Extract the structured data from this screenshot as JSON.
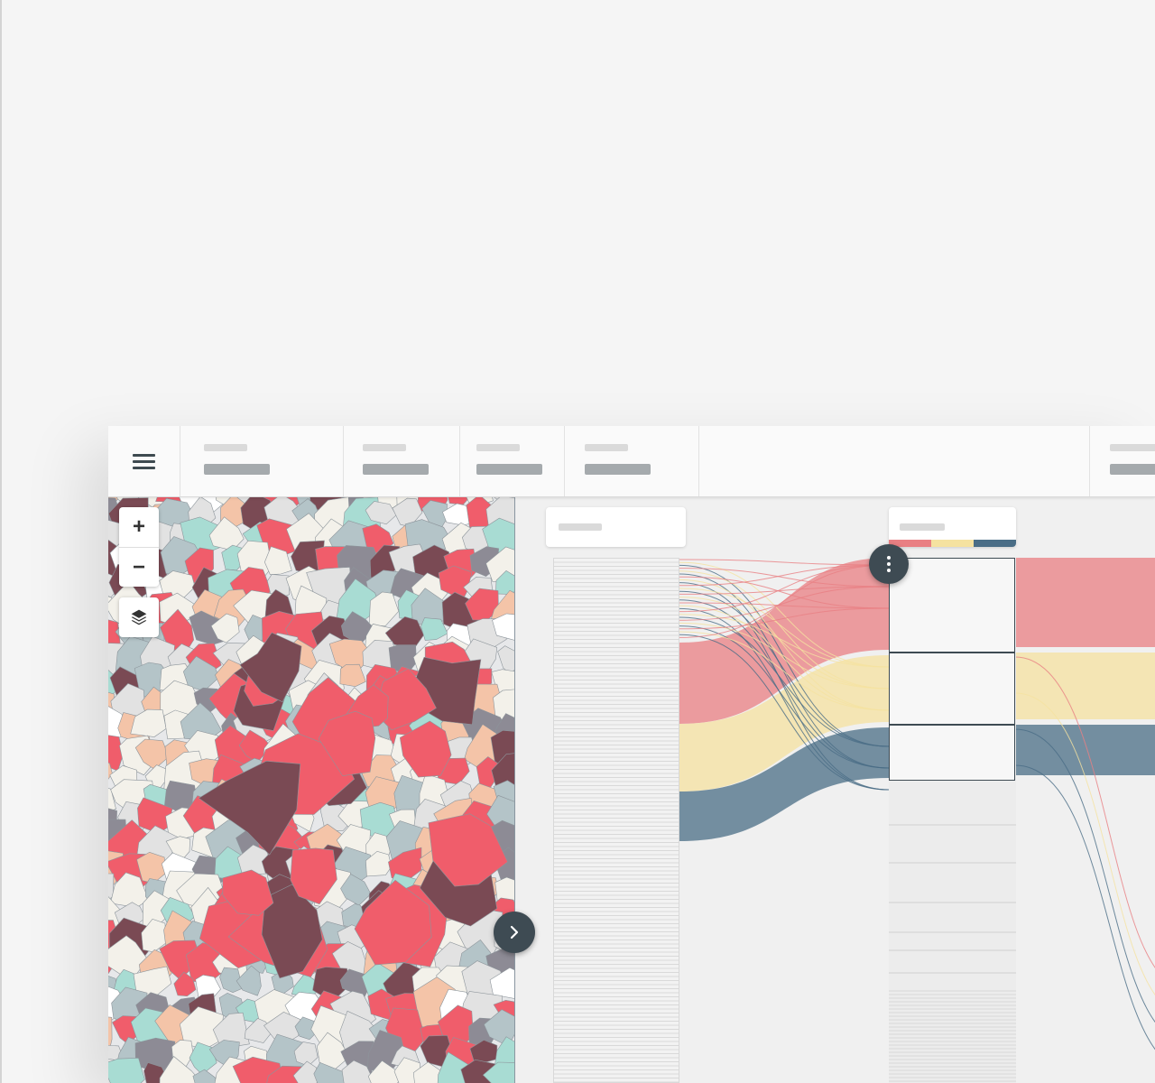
{
  "toolbar": {
    "menu_icon": "hamburger-menu-icon",
    "segments": [
      {
        "index": 1
      },
      {
        "index": 2
      },
      {
        "index": 3
      },
      {
        "index": 4
      },
      {
        "index": 5
      }
    ]
  },
  "map": {
    "zoom_in_label": "+",
    "zoom_out_label": "−",
    "layers_icon": "layers-icon",
    "collapse_icon": "chevron-right-icon",
    "region_colors": [
      "#f05d6b",
      "#7a4a54",
      "#f4c4a8",
      "#b4c4c8",
      "#a8dcd3",
      "#8d8b95",
      "#f3f1ea",
      "#e2e2e2",
      "#ffffff"
    ]
  },
  "flow": {
    "category_colors": {
      "red": "#e97f83",
      "yellow": "#f5e2a0",
      "blue": "#4a6d86"
    },
    "column_1_bands": [
      {
        "color": "red",
        "value": 90
      },
      {
        "color": "yellow",
        "value": 75
      },
      {
        "color": "blue",
        "value": 55
      }
    ],
    "column_2_nodes": [
      {
        "color": "red",
        "value": 105
      },
      {
        "color": "yellow",
        "value": 80
      },
      {
        "color": "blue",
        "value": 62
      }
    ],
    "options_icon": "more-vert-icon"
  }
}
